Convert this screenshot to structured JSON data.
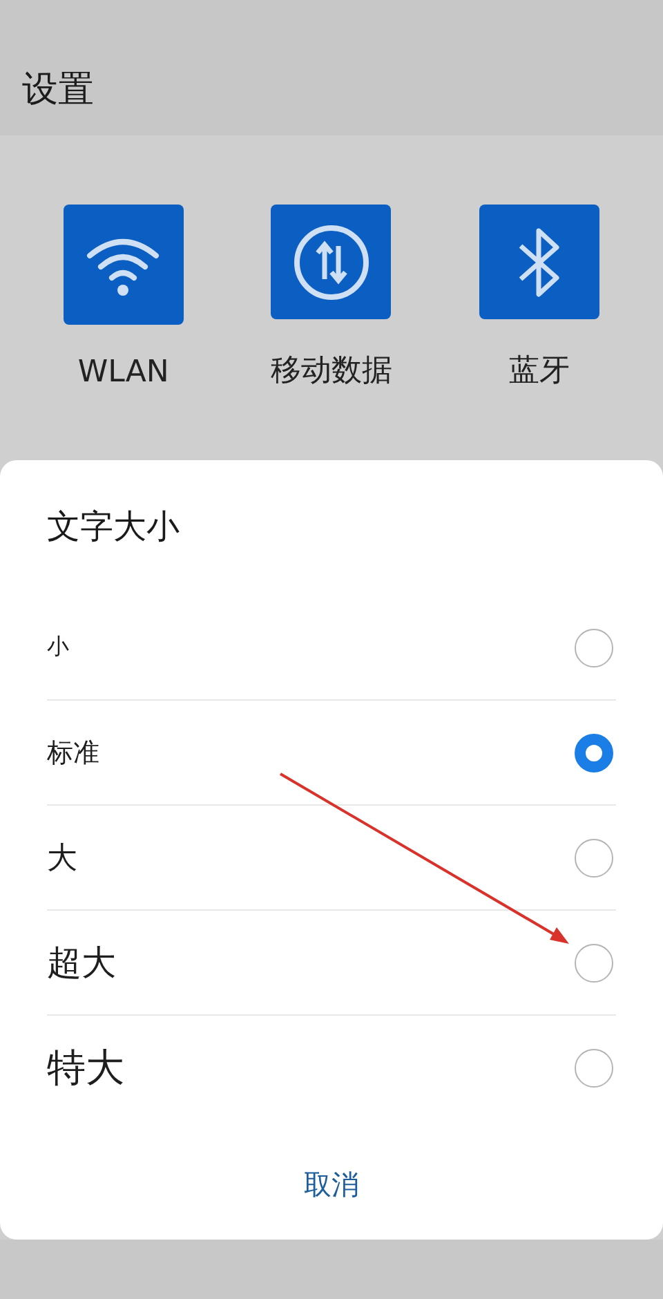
{
  "header": {
    "title": "设置"
  },
  "tiles": [
    {
      "kind": "wifi",
      "label": "WLAN"
    },
    {
      "kind": "data",
      "label": "移动数据"
    },
    {
      "kind": "bluetooth",
      "label": "蓝牙"
    }
  ],
  "dialog": {
    "title": "文字大小",
    "options": [
      {
        "label": "小",
        "selected": false
      },
      {
        "label": "标准",
        "selected": true
      },
      {
        "label": "大",
        "selected": false
      },
      {
        "label": "超大",
        "selected": false
      },
      {
        "label": "特大",
        "selected": false
      }
    ],
    "cancel": "取消"
  }
}
